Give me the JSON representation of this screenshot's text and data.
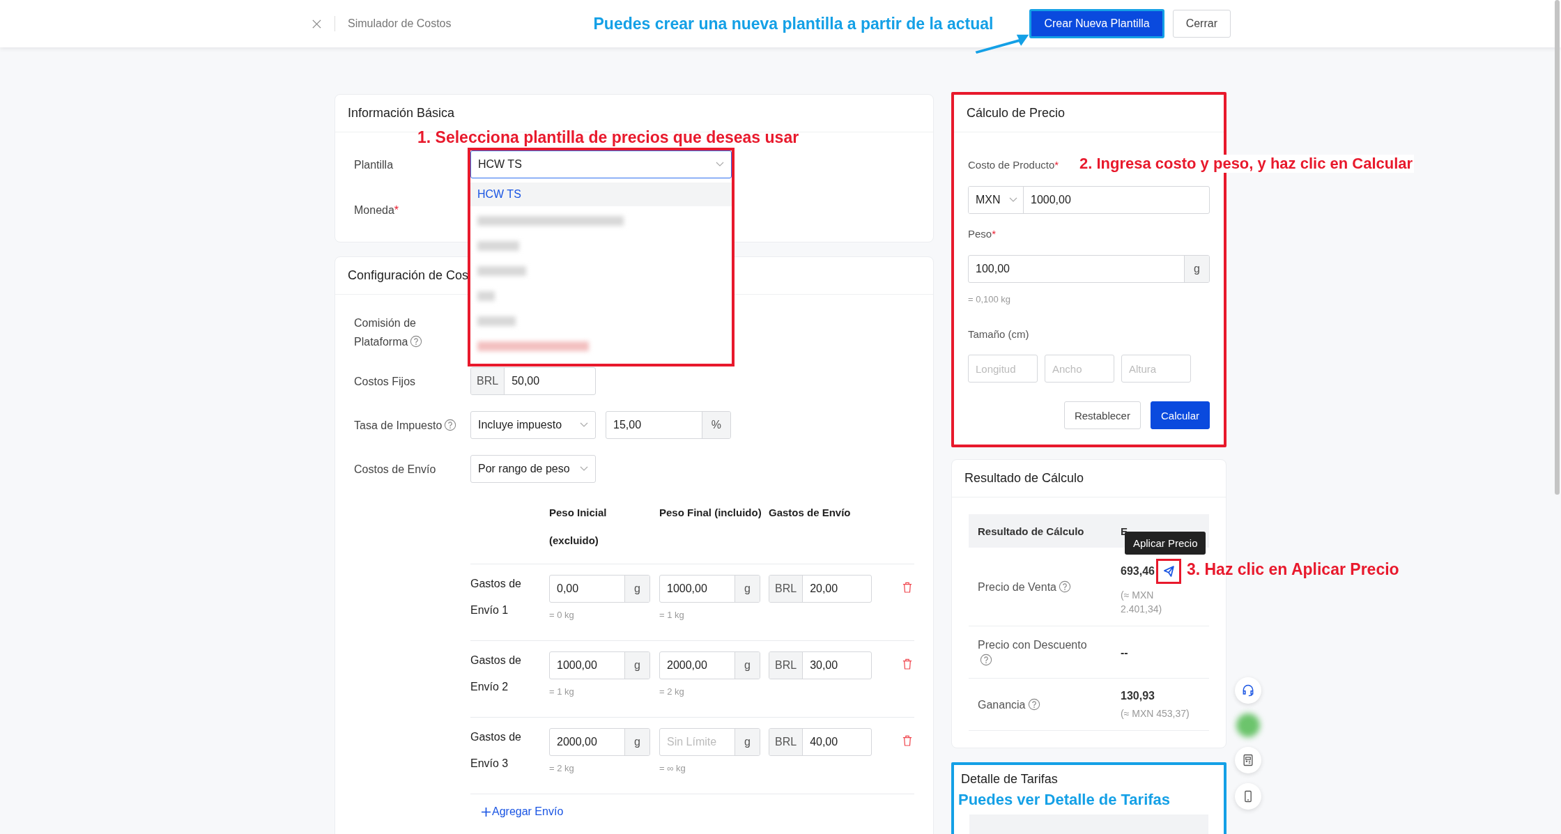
{
  "header": {
    "title": "Simulador de Costos",
    "annotation": "Puedes crear una nueva plantilla a partir de la actual",
    "buttons": [
      {
        "label": "Crear Nueva Plantilla",
        "kind": "primary",
        "highlighted": true
      },
      {
        "label": "Cerrar",
        "kind": "default",
        "highlighted": false
      }
    ]
  },
  "basic_info": {
    "title": "Información Básica",
    "annotation": "1. Selecciona plantilla de precios que deseas usar",
    "fields": [
      {
        "label": "Plantilla",
        "kind": "select",
        "value": "HCW TS",
        "expanded": true,
        "options": [
          {
            "label": "HCW TS",
            "selected": true
          }
        ]
      },
      {
        "label": "Moneda",
        "required_mark": "*",
        "kind": "covered"
      }
    ]
  },
  "cost_config": {
    "title": "Configuración de Cos",
    "rows": [
      {
        "label": "Comisión de Plataforma",
        "help": true,
        "kind": "covered"
      },
      {
        "label": "Costos Fijos",
        "help": false,
        "kind": "prefixed",
        "prefix": "BRL",
        "value": "50,00"
      },
      {
        "label": "Tasa de Impuesto",
        "help": true,
        "kind": "tax",
        "select": "Incluye impuesto",
        "value": "15,00",
        "suffix": "%"
      },
      {
        "label": "Costos de Envío",
        "help": false,
        "kind": "select",
        "select": "Por rango de peso"
      }
    ],
    "shipping": {
      "columns": [
        "Peso Inicial (excluido)",
        "Peso Final (incluido)",
        "Gastos de Envío"
      ],
      "rows": [
        {
          "label": "Gastos de Envío 1",
          "start": "0,00",
          "start_unit": "g",
          "start_note": "= 0 kg",
          "end": "1000,00",
          "end_unit": "g",
          "end_note": "= 1 kg",
          "currency": "BRL",
          "fee": "20,00"
        },
        {
          "label": "Gastos de Envío 2",
          "start": "1000,00",
          "start_unit": "g",
          "start_note": "= 1 kg",
          "end": "2000,00",
          "end_unit": "g",
          "end_note": "= 2 kg",
          "currency": "BRL",
          "fee": "30,00"
        },
        {
          "label": "Gastos de Envío 3",
          "start": "2000,00",
          "start_unit": "g",
          "start_note": "= 2 kg",
          "end_placeholder": "Sin Límite",
          "end_unit": "g",
          "end_note": "= ∞ kg",
          "currency": "BRL",
          "fee": "40,00"
        }
      ],
      "add_label": "Agregar Envío"
    }
  },
  "price_calc": {
    "title": "Cálculo de Precio",
    "annotation": "2. Ingresa costo y peso, y haz clic en Calcular",
    "cost": {
      "label": "Costo de Producto",
      "required_mark": "*",
      "currency": "MXN",
      "value": "1000,00"
    },
    "weight": {
      "label": "Peso",
      "required_mark": "*",
      "value": "100,00",
      "unit": "g",
      "note": "= 0,100 kg"
    },
    "size": {
      "label": "Tamaño (cm)",
      "placeholders": [
        "Longitud",
        "Ancho",
        "Altura"
      ]
    },
    "buttons": [
      {
        "label": "Restablecer",
        "kind": "default"
      },
      {
        "label": "Calcular",
        "kind": "primary"
      }
    ]
  },
  "result": {
    "title": "Resultado de Cálculo",
    "columns": [
      "Resultado de Cálculo",
      "E"
    ],
    "tooltip": "Aplicar Precio",
    "annotation": "3. Haz clic en Aplicar Precio",
    "rows": [
      {
        "label": "Precio de Venta",
        "help": true,
        "value": "693,46",
        "note": "(≈ MXN 2.401,34)",
        "apply": true
      },
      {
        "label": "Precio con Descuento",
        "help": true,
        "value": "--",
        "apply": false
      },
      {
        "label": "Ganancia",
        "help": true,
        "value": "130,93",
        "note": "(≈ MXN 453,37)",
        "apply": false
      }
    ]
  },
  "fee_detail": {
    "title": "Detalle de Tarifas",
    "annotation": "Puedes ver Detalle de Tarifas"
  }
}
